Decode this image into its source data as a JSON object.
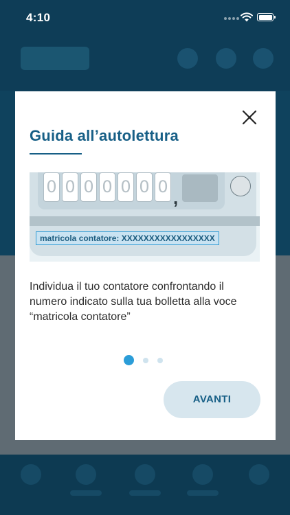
{
  "status_bar": {
    "time": "4:10",
    "icons": [
      "cellular-dots-icon",
      "wifi-icon",
      "battery-icon"
    ]
  },
  "modal": {
    "title": "Guida all’autolettura",
    "close_icon": "close-icon",
    "illustration": {
      "digits": [
        "0",
        "0",
        "0",
        "0",
        "0",
        "0",
        "0"
      ],
      "separator": ",",
      "serial_label": "matricola contatore: XXXXXXXXXXXXXXXXX"
    },
    "description": "Individua il tuo contatore confrontando il numero indicato sulla tua bolletta alla voce  “matricola contatore”",
    "pager": {
      "total": 3,
      "current": 1
    },
    "next_label": "AVANTI"
  },
  "colors": {
    "title": "#175f86",
    "accent": "#2b9dd8",
    "button_bg": "#d7e6ee",
    "overlay_dark": "#0d3a52"
  }
}
